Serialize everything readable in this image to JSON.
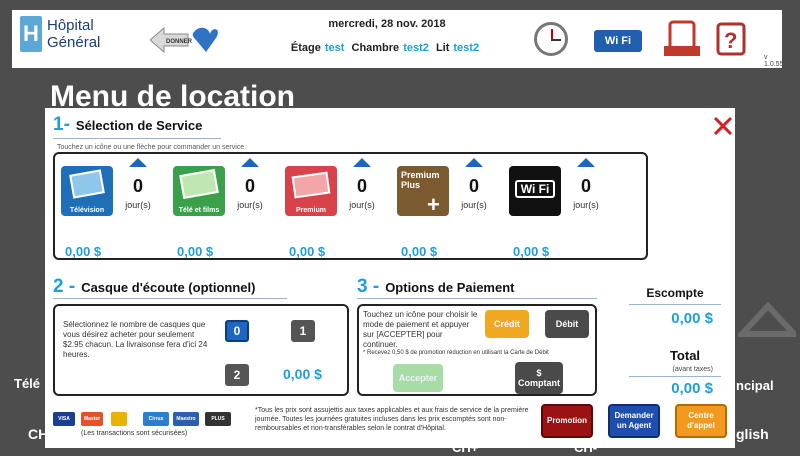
{
  "topbar": {
    "logo_line1": "Hôpital",
    "logo_line2": "Général",
    "logo_letter": "H",
    "donner_label": "DONNER",
    "date": "mercredi, 28 nov. 2018",
    "room_labels": {
      "etage": "Étage",
      "chambre": "Chambre",
      "lit": "Lit"
    },
    "room_values": {
      "etage": "test",
      "chambre": "test2",
      "lit": "test2"
    },
    "wifi_label": "Wi Fi",
    "version": "v 1.0.55",
    "icons": [
      "clock-icon",
      "wifi-icon",
      "voice-call-icon",
      "help-icon"
    ]
  },
  "background": {
    "title": "Menu de location",
    "partial_labels": [
      "Télé",
      "CH",
      "CH+",
      "CH-",
      "ncipal",
      "glish"
    ]
  },
  "modal": {
    "section1": {
      "num": "1-",
      "title": "Sélection de Service",
      "hint": "Touchez un icône ou une flèche pour commander un service."
    },
    "services": [
      {
        "name": "Télévision",
        "count": "0",
        "unit": "jour(s)",
        "price": "0,00 $",
        "color": "#1f6fb8"
      },
      {
        "name": "Télé et films",
        "count": "0",
        "unit": "jour(s)",
        "price": "0,00 $",
        "color": "#3aa04a"
      },
      {
        "name": "Premium",
        "count": "0",
        "unit": "jour(s)",
        "price": "0,00 $",
        "color": "#d8434b"
      },
      {
        "name": "Premium Plus",
        "count": "0",
        "unit": "jour(s)",
        "price": "0,00 $",
        "color": "#7a5a2e"
      },
      {
        "name": "Wi Fi",
        "count": "0",
        "unit": "jour(s)",
        "price": "0,00 $",
        "color": "#111111"
      }
    ],
    "section2": {
      "num": "2 -",
      "title": "Casque d'écoute (optionnel)",
      "desc": "Sélectionnez le nombre de casques que vous désirez acheter pour seulement $2.95 chacun. La livraisonse fera d'ici 24 heures.",
      "qty_buttons": [
        "0",
        "1",
        "2"
      ],
      "total": "0,00 $"
    },
    "section3": {
      "num": "3 -",
      "title": "Options de Paiement",
      "desc": "Touchez un icône pour choisir le mode de paiement et appuyer sur [ACCEPTER] pour continuer.",
      "promo_note": "* Recevez 0,50 $ de promotion réduction en utilisant la Carte de Débit",
      "credit_label": "Crédit",
      "debit_label": "Débit",
      "accept_label": "Accepter",
      "cash_label": "Comptant",
      "cash_symbol": "$"
    },
    "summary": {
      "discount_label": "Escompte",
      "discount_value": "0,00 $",
      "total_label": "Total",
      "total_note": "(avant taxes)",
      "total_value": "0,00 $"
    },
    "footer": {
      "cards": [
        "VISA",
        "Master",
        "Cirrus",
        "Maestro",
        "PLUS"
      ],
      "secure_note": "(Les transactions sont sécurisées)",
      "disclaimer": "*Tous les prix sont assujettis aux taxes applicables et aux frais de service de la première journée. Toutes les journées gratuites incluses dans les prix escomptés sont non-remboursables et non-transférables selon le contrat d'Hôpital.",
      "promotion_label": "Promotion",
      "agent_label": "Demander un Agent",
      "call_label": "Centre d'appel"
    }
  }
}
